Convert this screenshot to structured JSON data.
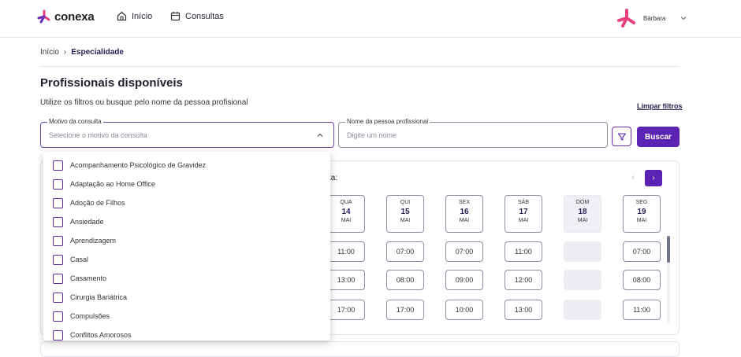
{
  "header": {
    "logo_text": "conexa",
    "nav": [
      {
        "label": "Início",
        "icon": "home-icon"
      },
      {
        "label": "Consultas",
        "icon": "calendar-icon"
      }
    ],
    "user_name": "Bárbara"
  },
  "breadcrumb": {
    "home": "Início",
    "separator": "›",
    "current": "Especialidade"
  },
  "main": {
    "title": "Profissionais disponíveis",
    "subtitle": "Utilize os filtros ou busque pelo nome da pessoa profisional",
    "clear_filters": "Limpar filtros"
  },
  "filters": {
    "reason": {
      "label": "Motivo da consulta",
      "placeholder": "Selecione o motivo da consulta"
    },
    "name": {
      "label": "Nome da pessoa profissional",
      "placeholder": "Digite um nome"
    },
    "search_button": "Buscar"
  },
  "schedule": {
    "partial_label": "ta:",
    "prev": "‹",
    "next": "›",
    "days": [
      {
        "dow": "QUA",
        "num": "14",
        "mon": "MAI",
        "disabled": false,
        "slots": [
          "11:00",
          "13:00",
          "17:00"
        ]
      },
      {
        "dow": "QUI",
        "num": "15",
        "mon": "MAI",
        "disabled": false,
        "slots": [
          "07:00",
          "08:00",
          "17:00"
        ]
      },
      {
        "dow": "SEX",
        "num": "16",
        "mon": "MAI",
        "disabled": false,
        "slots": [
          "07:00",
          "09:00",
          "10:00"
        ]
      },
      {
        "dow": "SÁB",
        "num": "17",
        "mon": "MAI",
        "disabled": false,
        "slots": [
          "11:00",
          "12:00",
          "13:00"
        ]
      },
      {
        "dow": "DOM",
        "num": "18",
        "mon": "MAI",
        "disabled": true,
        "slots": [
          "",
          "",
          ""
        ]
      },
      {
        "dow": "SEG",
        "num": "19",
        "mon": "MAI",
        "disabled": false,
        "slots": [
          "07:00",
          "08:00",
          "11:00"
        ]
      }
    ]
  },
  "dropdown": {
    "options": [
      "Acompanhamento Psicológico de Gravidez",
      "Adaptação ao Home Office",
      "Adoção de Filhos",
      "Ansiedade",
      "Aprendizagem",
      "Casal",
      "Casamento",
      "Cirurgia Bariátrica",
      "Compulsões",
      "Conflitos Amorosos"
    ]
  },
  "colors": {
    "accent": "#5a23b3",
    "brand_pink": "#e8407a",
    "brand_purple": "#6b2bb5"
  }
}
